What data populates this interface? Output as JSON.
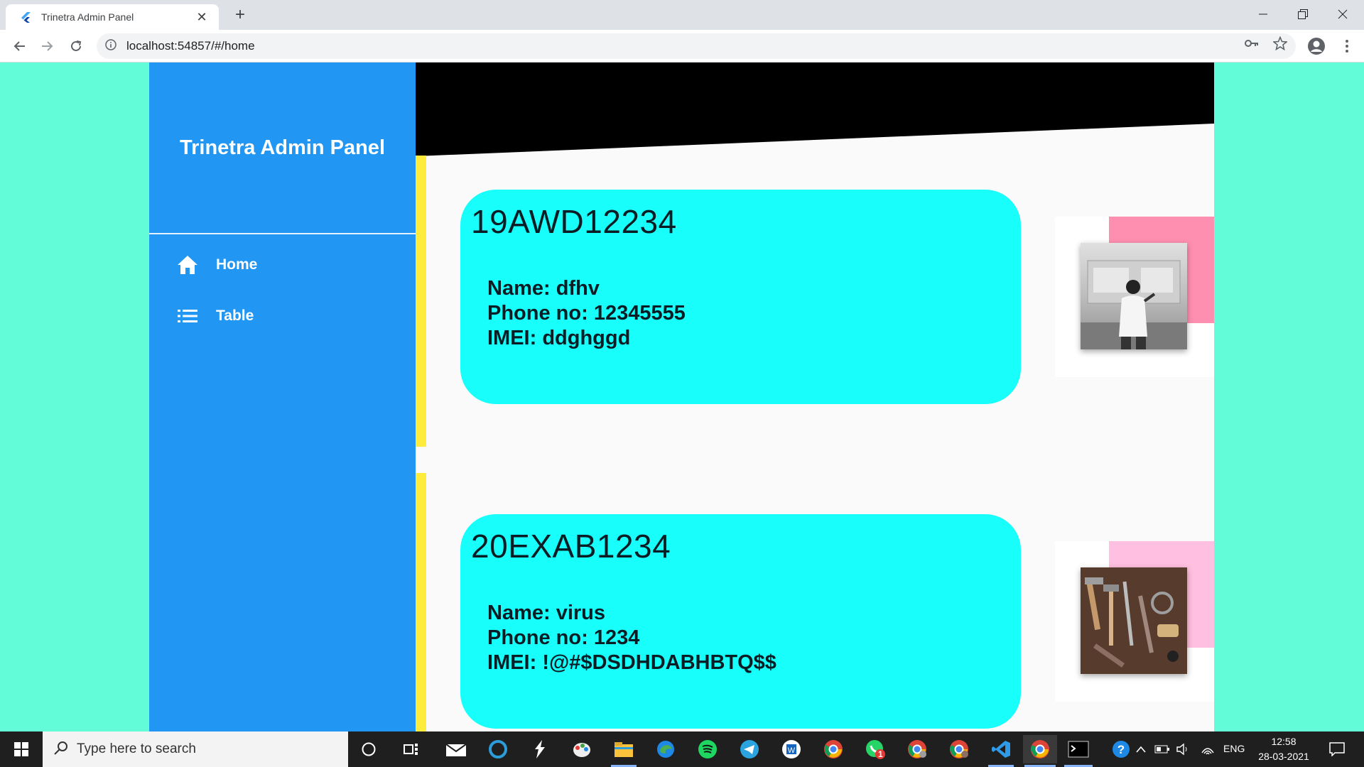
{
  "browser": {
    "tab_title": "Trinetra Admin Panel",
    "tab_close": "✕",
    "new_tab": "+",
    "url": "localhost:54857/#/home"
  },
  "app": {
    "brand": "Trinetra Admin Panel",
    "nav": [
      {
        "label": "Home",
        "icon": "home-icon"
      },
      {
        "label": "Table",
        "icon": "list-icon"
      }
    ],
    "colors": {
      "background": "#62fcd9",
      "sidebar": "#2196f3",
      "card": "#18fffb",
      "accent_bar": "#ffeb3b",
      "banner": "#000000",
      "photo_accent_1": "#ff8fb1",
      "photo_accent_2": "#ffbfe0"
    },
    "devices": [
      {
        "code": "19AWD12234",
        "name": "Name: dfhv",
        "phone": "Phone no: 12345555",
        "imei": "IMEI: ddghggd",
        "photo": "woman-at-train-photo"
      },
      {
        "code": "20EXAB1234",
        "name": "Name: virus",
        "phone": "Phone no: 1234",
        "imei": "IMEI: !@#$DSDHDABHBTQ$$",
        "photo": "tools-photo"
      }
    ]
  },
  "taskbar": {
    "search_placeholder": "Type here to search",
    "language": "ENG",
    "time": "12:58",
    "date": "28-03-2021",
    "whatsapp_badge": "1"
  }
}
